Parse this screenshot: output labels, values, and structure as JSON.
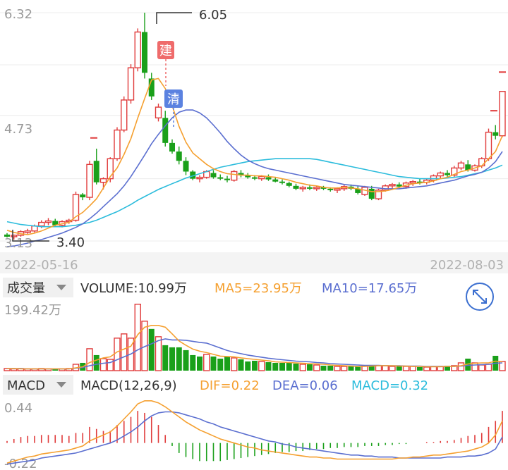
{
  "colors": {
    "up": "#e03b3b",
    "down": "#1aa01a",
    "ma5": "#f5a030",
    "ma10": "#5b6fd0",
    "ma20": "#2bbcdc",
    "text": "#333333",
    "axis_text": "#9a9a9a",
    "grid": "#ececec"
  },
  "price_panel": {
    "y_max_label": "6.32",
    "y_mid_label": "4.73",
    "y_min_label": "3.13",
    "high_marker": "6.05",
    "low_marker": "3.40",
    "build_tag": "建",
    "clear_tag": "清",
    "date_start": "2022-05-16",
    "date_end": "2022-08-03"
  },
  "volume_panel": {
    "selector": "成交量",
    "volume_label": "VOLUME:10.99万",
    "ma5_label": "MA5=23.95万",
    "ma10_label": "MA10=17.65万",
    "y_max_label": "199.42万",
    "expand_icon": "expand-arrows-icon"
  },
  "macd_panel": {
    "selector": "MACD",
    "params_label": "MACD(12,26,9)",
    "dif_label": "DIF=0.22",
    "dea_label": "DEA=0.06",
    "macd_label": "MACD=0.32",
    "y_max_label": "0.44",
    "y_min_label": "-0.22"
  },
  "chart_data": [
    {
      "type": "candlestick",
      "x": [
        "2022-05-16",
        "2022-08-03"
      ],
      "ylim": [
        3.13,
        6.32
      ],
      "high": 6.05,
      "low": 3.4,
      "ohlc": [
        [
          3.22,
          3.24,
          3.18,
          3.19
        ],
        [
          3.19,
          3.22,
          3.15,
          3.21
        ],
        [
          3.21,
          3.28,
          3.19,
          3.26
        ],
        [
          3.26,
          3.3,
          3.23,
          3.27
        ],
        [
          3.27,
          3.36,
          3.25,
          3.34
        ],
        [
          3.34,
          3.42,
          3.31,
          3.39
        ],
        [
          3.39,
          3.45,
          3.35,
          3.41
        ],
        [
          3.41,
          3.44,
          3.33,
          3.35
        ],
        [
          3.35,
          3.42,
          3.32,
          3.4
        ],
        [
          3.4,
          3.44,
          3.37,
          3.42
        ],
        [
          3.42,
          3.82,
          3.4,
          3.78
        ],
        [
          3.78,
          3.8,
          3.7,
          3.74
        ],
        [
          3.74,
          4.25,
          3.7,
          4.2
        ],
        [
          4.25,
          4.42,
          3.92,
          3.95
        ],
        [
          3.95,
          4.02,
          3.85,
          4.0
        ],
        [
          4.0,
          4.3,
          3.95,
          4.28
        ],
        [
          4.28,
          4.72,
          4.25,
          4.68
        ],
        [
          4.68,
          5.15,
          4.65,
          5.1
        ],
        [
          5.1,
          5.6,
          5.05,
          5.55
        ],
        [
          5.55,
          6.1,
          5.5,
          6.05
        ],
        [
          6.05,
          6.32,
          5.4,
          5.48
        ],
        [
          5.4,
          5.48,
          5.1,
          5.15
        ],
        [
          4.85,
          5.05,
          4.8,
          5.0
        ],
        [
          4.85,
          4.95,
          4.45,
          4.5
        ],
        [
          4.5,
          4.55,
          4.35,
          4.38
        ],
        [
          4.38,
          4.45,
          4.2,
          4.25
        ],
        [
          4.25,
          4.3,
          4.05,
          4.1
        ],
        [
          4.1,
          4.12,
          3.98,
          4.0
        ],
        [
          4.0,
          4.05,
          3.95,
          4.02
        ],
        [
          4.02,
          4.12,
          4.0,
          4.1
        ],
        [
          4.08,
          4.12,
          4.0,
          4.02
        ],
        [
          4.02,
          4.06,
          3.98,
          4.0
        ],
        [
          4.0,
          4.04,
          3.95,
          3.98
        ],
        [
          3.98,
          4.12,
          3.96,
          4.1
        ],
        [
          4.08,
          4.12,
          4.02,
          4.05
        ],
        [
          4.05,
          4.08,
          4.0,
          4.02
        ],
        [
          4.02,
          4.05,
          3.98,
          4.0
        ],
        [
          4.0,
          4.05,
          3.97,
          4.03
        ],
        [
          4.02,
          4.06,
          3.97,
          3.99
        ],
        [
          3.99,
          4.02,
          3.95,
          3.96
        ],
        [
          3.96,
          3.99,
          3.92,
          3.94
        ],
        [
          3.94,
          3.96,
          3.88,
          3.9
        ],
        [
          3.9,
          3.93,
          3.84,
          3.86
        ],
        [
          3.86,
          3.9,
          3.82,
          3.88
        ],
        [
          3.88,
          3.92,
          3.84,
          3.86
        ],
        [
          3.86,
          3.9,
          3.83,
          3.88
        ],
        [
          3.88,
          3.9,
          3.84,
          3.86
        ],
        [
          3.86,
          3.88,
          3.82,
          3.84
        ],
        [
          3.84,
          3.88,
          3.8,
          3.86
        ],
        [
          3.86,
          3.92,
          3.83,
          3.89
        ],
        [
          3.89,
          3.92,
          3.84,
          3.86
        ],
        [
          3.86,
          3.9,
          3.78,
          3.8
        ],
        [
          3.78,
          3.9,
          3.76,
          3.88
        ],
        [
          3.86,
          3.9,
          3.7,
          3.72
        ],
        [
          3.72,
          3.86,
          3.7,
          3.84
        ],
        [
          3.84,
          3.92,
          3.82,
          3.9
        ],
        [
          3.9,
          3.94,
          3.86,
          3.92
        ],
        [
          3.92,
          3.95,
          3.87,
          3.89
        ],
        [
          3.89,
          3.96,
          3.86,
          3.94
        ],
        [
          3.94,
          3.98,
          3.9,
          3.96
        ],
        [
          3.96,
          4.0,
          3.92,
          3.95
        ],
        [
          3.95,
          4.0,
          3.92,
          3.98
        ],
        [
          3.98,
          4.06,
          3.95,
          4.04
        ],
        [
          4.04,
          4.1,
          4.0,
          4.08
        ],
        [
          4.08,
          4.12,
          4.02,
          4.05
        ],
        [
          4.05,
          4.18,
          4.02,
          4.15
        ],
        [
          4.15,
          4.25,
          4.12,
          4.22
        ],
        [
          4.2,
          4.26,
          4.1,
          4.12
        ],
        [
          4.12,
          4.2,
          4.1,
          4.18
        ],
        [
          4.18,
          4.3,
          4.15,
          4.28
        ],
        [
          4.28,
          4.7,
          4.25,
          4.65
        ],
        [
          4.65,
          4.75,
          4.55,
          4.6
        ],
        [
          4.6,
          5.0,
          4.58,
          5.22
        ]
      ],
      "ma5": [
        3.28,
        3.25,
        3.23,
        3.22,
        3.24,
        3.27,
        3.31,
        3.35,
        3.37,
        3.39,
        3.47,
        3.53,
        3.62,
        3.72,
        3.87,
        4.03,
        4.15,
        4.34,
        4.56,
        4.85,
        5.12,
        5.38,
        5.4,
        5.26,
        5.02,
        4.73,
        4.51,
        4.36,
        4.28,
        4.2,
        4.14,
        4.1,
        4.07,
        4.06,
        4.05,
        4.05,
        4.04,
        4.04,
        4.03,
        4.02,
        4.0,
        3.98,
        3.95,
        3.93,
        3.91,
        3.9,
        3.88,
        3.87,
        3.87,
        3.88,
        3.87,
        3.86,
        3.84,
        3.82,
        3.82,
        3.83,
        3.85,
        3.88,
        3.91,
        3.93,
        3.94,
        3.95,
        3.97,
        4.0,
        4.02,
        4.06,
        4.1,
        4.12,
        4.15,
        4.18,
        4.28,
        4.38,
        4.6
      ],
      "ma10": [
        3.05,
        3.06,
        3.08,
        3.1,
        3.13,
        3.15,
        3.18,
        3.21,
        3.24,
        3.28,
        3.32,
        3.37,
        3.44,
        3.52,
        3.61,
        3.7,
        3.79,
        3.9,
        4.03,
        4.18,
        4.33,
        4.49,
        4.62,
        4.74,
        4.85,
        4.93,
        4.96,
        4.96,
        4.92,
        4.85,
        4.75,
        4.64,
        4.52,
        4.42,
        4.33,
        4.26,
        4.21,
        4.17,
        4.14,
        4.12,
        4.1,
        4.08,
        4.06,
        4.04,
        4.02,
        4.0,
        3.98,
        3.96,
        3.94,
        3.92,
        3.91,
        3.9,
        3.89,
        3.88,
        3.87,
        3.86,
        3.86,
        3.86,
        3.87,
        3.88,
        3.89,
        3.9,
        3.92,
        3.94,
        3.96,
        3.98,
        4.01,
        4.04,
        4.06,
        4.09,
        4.15,
        4.24,
        4.38
      ],
      "ma20": [
        3.4,
        3.38,
        3.36,
        3.35,
        3.34,
        3.33,
        3.33,
        3.33,
        3.33,
        3.34,
        3.35,
        3.37,
        3.39,
        3.42,
        3.46,
        3.5,
        3.54,
        3.59,
        3.64,
        3.7,
        3.75,
        3.8,
        3.85,
        3.89,
        3.93,
        3.97,
        4.01,
        4.04,
        4.07,
        4.1,
        4.13,
        4.16,
        4.18,
        4.2,
        4.22,
        4.24,
        4.25,
        4.26,
        4.27,
        4.28,
        4.28,
        4.28,
        4.28,
        4.28,
        4.28,
        4.27,
        4.25,
        4.23,
        4.21,
        4.19,
        4.17,
        4.15,
        4.13,
        4.11,
        4.09,
        4.07,
        4.05,
        4.03,
        4.02,
        4.01,
        4.0,
        4.0,
        4.0,
        4.0,
        4.01,
        4.02,
        4.03,
        4.05,
        4.07,
        4.09,
        4.12,
        4.15,
        4.19
      ]
    },
    {
      "type": "bar",
      "title": "VOLUME",
      "unit": "万",
      "ylim": [
        0,
        199.42
      ],
      "values": [
        6,
        5,
        6,
        5,
        5,
        6,
        5,
        6,
        5,
        6,
        18,
        22,
        62,
        44,
        34,
        32,
        92,
        104,
        92,
        188,
        140,
        118,
        96,
        72,
        66,
        66,
        58,
        44,
        40,
        46,
        40,
        34,
        40,
        36,
        32,
        26,
        28,
        26,
        24,
        22,
        22,
        22,
        20,
        18,
        18,
        16,
        14,
        14,
        12,
        12,
        12,
        12,
        14,
        16,
        14,
        14,
        12,
        12,
        12,
        12,
        10,
        10,
        12,
        12,
        14,
        14,
        22,
        34,
        22,
        16,
        18,
        42,
        26
      ],
      "up": [
        true,
        true,
        true,
        true,
        true,
        true,
        true,
        false,
        true,
        true,
        true,
        false,
        true,
        false,
        true,
        true,
        true,
        true,
        true,
        true,
        true,
        false,
        true,
        false,
        false,
        false,
        false,
        false,
        false,
        true,
        false,
        false,
        false,
        true,
        false,
        false,
        false,
        true,
        false,
        false,
        false,
        false,
        false,
        true,
        false,
        true,
        false,
        false,
        true,
        true,
        false,
        false,
        true,
        false,
        true,
        true,
        true,
        false,
        true,
        true,
        false,
        true,
        true,
        true,
        false,
        true,
        true,
        false,
        true,
        true,
        true,
        false,
        true
      ],
      "ma5": [
        6,
        6,
        5,
        5,
        5,
        5,
        5,
        5,
        5,
        5,
        8,
        11,
        23,
        30,
        36,
        39,
        53,
        61,
        69,
        102,
        123,
        128,
        128,
        123,
        104,
        84,
        72,
        61,
        55,
        51,
        46,
        41,
        40,
        39,
        36,
        34,
        32,
        30,
        28,
        25,
        24,
        23,
        22,
        21,
        20,
        19,
        18,
        16,
        15,
        14,
        13,
        12,
        12,
        13,
        14,
        14,
        14,
        13,
        13,
        12,
        12,
        11,
        11,
        11,
        12,
        12,
        14,
        19,
        21,
        22,
        22,
        27,
        25
      ],
      "ma10": [
        6,
        6,
        6,
        5,
        5,
        5,
        5,
        5,
        5,
        5,
        7,
        9,
        14,
        18,
        21,
        23,
        31,
        39,
        47,
        59,
        68,
        76,
        85,
        90,
        87,
        87,
        86,
        83,
        80,
        78,
        71,
        64,
        57,
        52,
        48,
        44,
        41,
        38,
        35,
        33,
        31,
        29,
        27,
        26,
        25,
        23,
        22,
        20,
        19,
        18,
        17,
        16,
        15,
        15,
        15,
        14,
        14,
        14,
        13,
        13,
        13,
        12,
        12,
        12,
        12,
        12,
        13,
        15,
        16,
        17,
        18,
        21,
        22
      ]
    },
    {
      "type": "bar",
      "title": "MACD(12,26,9)",
      "ylim": [
        -0.22,
        0.44
      ],
      "dif": 0.22,
      "dea": 0.06,
      "macd": 0.32,
      "histogram": [
        0.02,
        0.04,
        0.06,
        0.07,
        0.07,
        0.08,
        0.08,
        0.08,
        0.08,
        0.07,
        0.1,
        0.1,
        0.16,
        0.14,
        0.12,
        0.12,
        0.18,
        0.22,
        0.26,
        0.32,
        0.3,
        0.26,
        0.18,
        0.08,
        -0.03,
        -0.1,
        -0.14,
        -0.16,
        -0.18,
        -0.18,
        -0.18,
        -0.18,
        -0.17,
        -0.16,
        -0.15,
        -0.14,
        -0.13,
        -0.12,
        -0.11,
        -0.1,
        -0.09,
        -0.09,
        -0.08,
        -0.08,
        -0.07,
        -0.06,
        -0.06,
        -0.05,
        -0.05,
        -0.04,
        -0.04,
        -0.04,
        -0.03,
        -0.03,
        -0.03,
        -0.02,
        -0.02,
        -0.01,
        -0.01,
        0.0,
        0.0,
        0.01,
        0.01,
        0.02,
        0.02,
        0.03,
        0.05,
        0.07,
        0.08,
        0.1,
        0.16,
        0.22,
        0.32
      ],
      "dif_line": [
        -0.2,
        -0.18,
        -0.16,
        -0.14,
        -0.13,
        -0.11,
        -0.1,
        -0.09,
        -0.08,
        -0.07,
        -0.05,
        -0.03,
        0.02,
        0.05,
        0.08,
        0.11,
        0.17,
        0.24,
        0.31,
        0.39,
        0.42,
        0.42,
        0.4,
        0.36,
        0.31,
        0.26,
        0.21,
        0.17,
        0.13,
        0.1,
        0.07,
        0.04,
        0.02,
        0.0,
        -0.02,
        -0.04,
        -0.05,
        -0.07,
        -0.08,
        -0.09,
        -0.1,
        -0.11,
        -0.12,
        -0.13,
        -0.14,
        -0.14,
        -0.15,
        -0.15,
        -0.16,
        -0.16,
        -0.16,
        -0.16,
        -0.16,
        -0.16,
        -0.16,
        -0.16,
        -0.16,
        -0.15,
        -0.15,
        -0.14,
        -0.14,
        -0.13,
        -0.12,
        -0.12,
        -0.11,
        -0.1,
        -0.09,
        -0.08,
        -0.06,
        -0.04,
        0.0,
        0.08,
        0.22
      ],
      "dea_line": [
        -0.21,
        -0.2,
        -0.19,
        -0.18,
        -0.17,
        -0.15,
        -0.14,
        -0.13,
        -0.12,
        -0.11,
        -0.1,
        -0.08,
        -0.06,
        -0.04,
        -0.02,
        0.0,
        0.03,
        0.07,
        0.11,
        0.16,
        0.22,
        0.27,
        0.3,
        0.31,
        0.31,
        0.3,
        0.28,
        0.26,
        0.24,
        0.21,
        0.19,
        0.16,
        0.14,
        0.12,
        0.1,
        0.08,
        0.06,
        0.04,
        0.02,
        0.01,
        -0.01,
        -0.02,
        -0.04,
        -0.05,
        -0.06,
        -0.07,
        -0.08,
        -0.09,
        -0.1,
        -0.11,
        -0.12,
        -0.12,
        -0.13,
        -0.13,
        -0.14,
        -0.14,
        -0.14,
        -0.15,
        -0.15,
        -0.15,
        -0.15,
        -0.15,
        -0.15,
        -0.15,
        -0.14,
        -0.14,
        -0.14,
        -0.13,
        -0.13,
        -0.12,
        -0.1,
        -0.06,
        0.06
      ]
    }
  ]
}
